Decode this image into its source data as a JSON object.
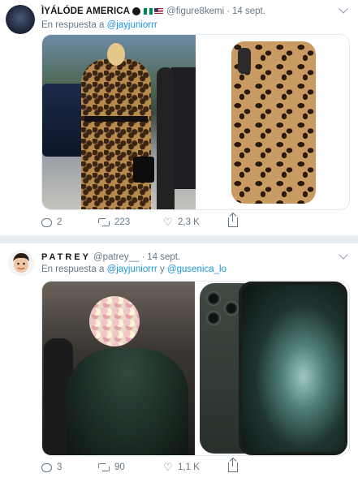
{
  "tweets": [
    {
      "display_name": "ÌYÁLÓDE AMERICA",
      "handle": "@figure8kemi",
      "separator": "·",
      "time": "14 sept.",
      "reply_prefix": "En respuesta a",
      "reply_to": [
        "@jayjuniorrr"
      ],
      "reply_joiner": "",
      "media": [
        "photo-leopard-coat-outfit",
        "photo-leopard-phone-case"
      ],
      "stats": {
        "replies": "2",
        "retweets": "223",
        "likes": "2,3 K"
      }
    },
    {
      "display_name": "PATREY",
      "handle": "@patrey__",
      "separator": "·",
      "time": "14 sept.",
      "reply_prefix": "En respuesta a",
      "reply_to": [
        "@jayjuniorrr",
        "@gusenica_lo"
      ],
      "reply_joiner": "y",
      "media": [
        "photo-flower-headpiece-gown",
        "photo-midnight-green-phone"
      ],
      "stats": {
        "replies": "3",
        "retweets": "90",
        "likes": "1,1 K"
      }
    }
  ],
  "icons": {
    "reply": "reply-icon",
    "retweet": "retweet-icon",
    "like": "heart-icon",
    "share": "share-icon",
    "menu": "chevron-down-icon",
    "verified": "verified-badge-icon",
    "flags": [
      "nigeria-flag-icon",
      "usa-flag-icon"
    ]
  },
  "colors": {
    "link": "#1b95e0",
    "muted": "#657786",
    "text": "#14171a",
    "separator": "#e6ecf0"
  }
}
